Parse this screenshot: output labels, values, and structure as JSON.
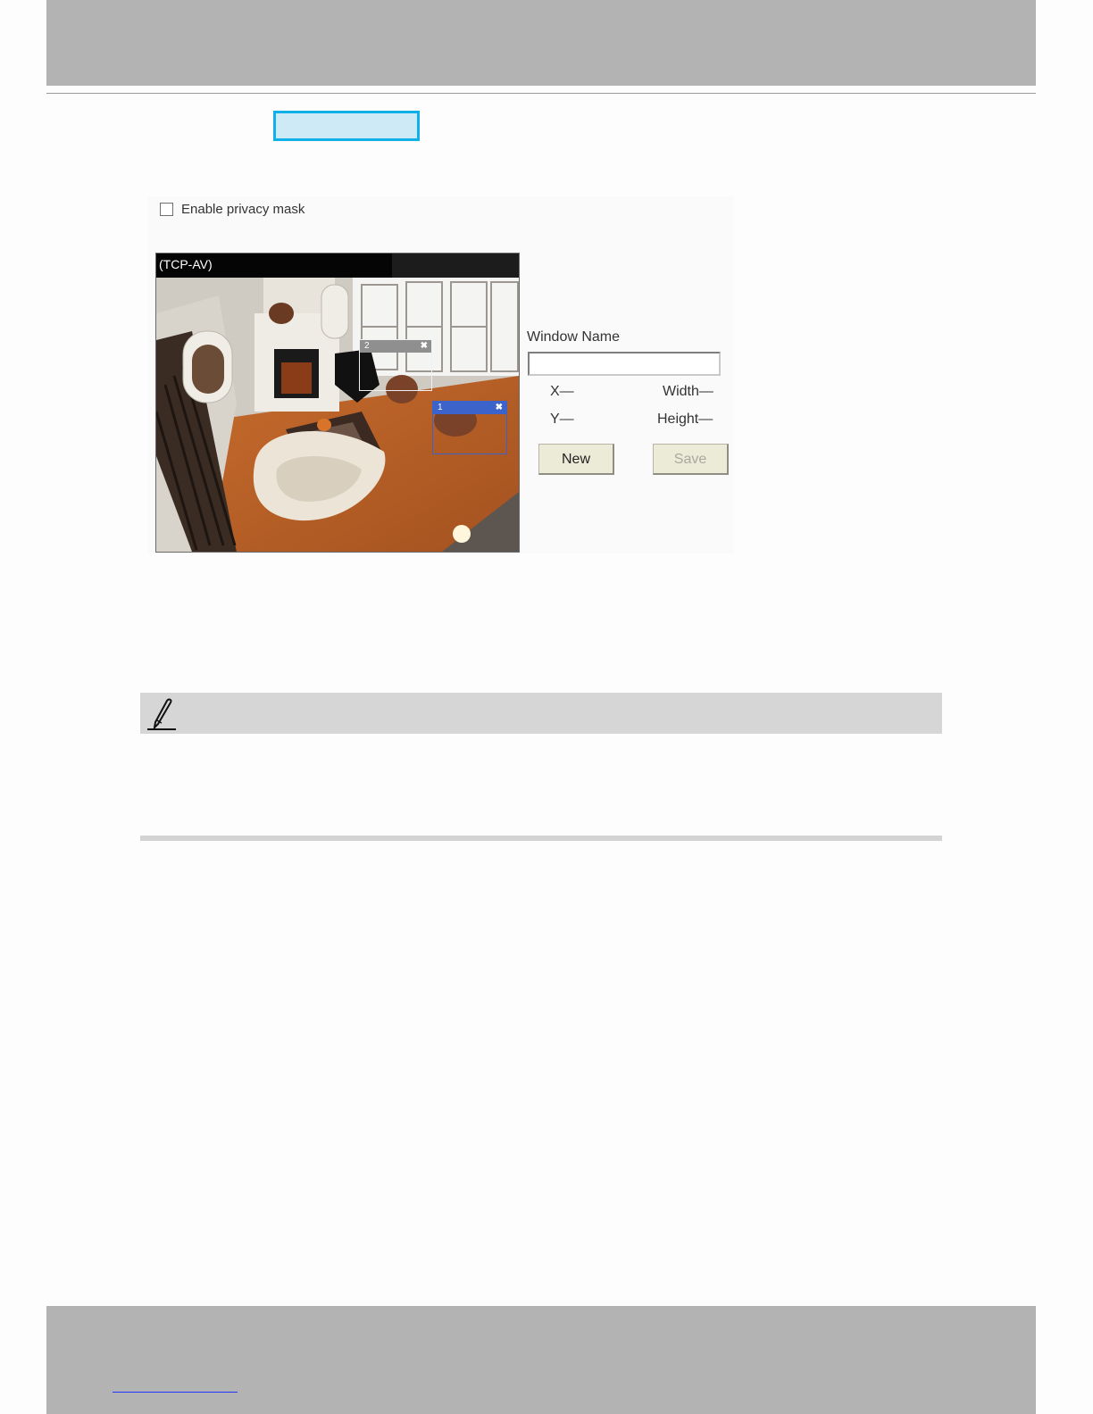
{
  "privacy": {
    "enable_label": "Enable privacy mask",
    "enabled": false
  },
  "video": {
    "title": "(TCP-AV)",
    "masks": [
      {
        "label": "1",
        "selected": true,
        "color": "#3c63c9"
      },
      {
        "label": "2",
        "selected": false,
        "color": "#8f8f8f"
      }
    ],
    "close_glyph": "✖"
  },
  "form": {
    "window_name_label": "Window Name",
    "window_name_value": "",
    "x_label": "X—",
    "y_label": "Y—",
    "width_label": "Width—",
    "height_label": "Height—",
    "new_button": "New",
    "save_button": "Save"
  },
  "note": {
    "icon": "pencil-note-icon"
  },
  "colors": {
    "tab_highlight": "#11b0e8",
    "band_gray": "#b3b3b3",
    "link_blue": "#2336ff"
  }
}
